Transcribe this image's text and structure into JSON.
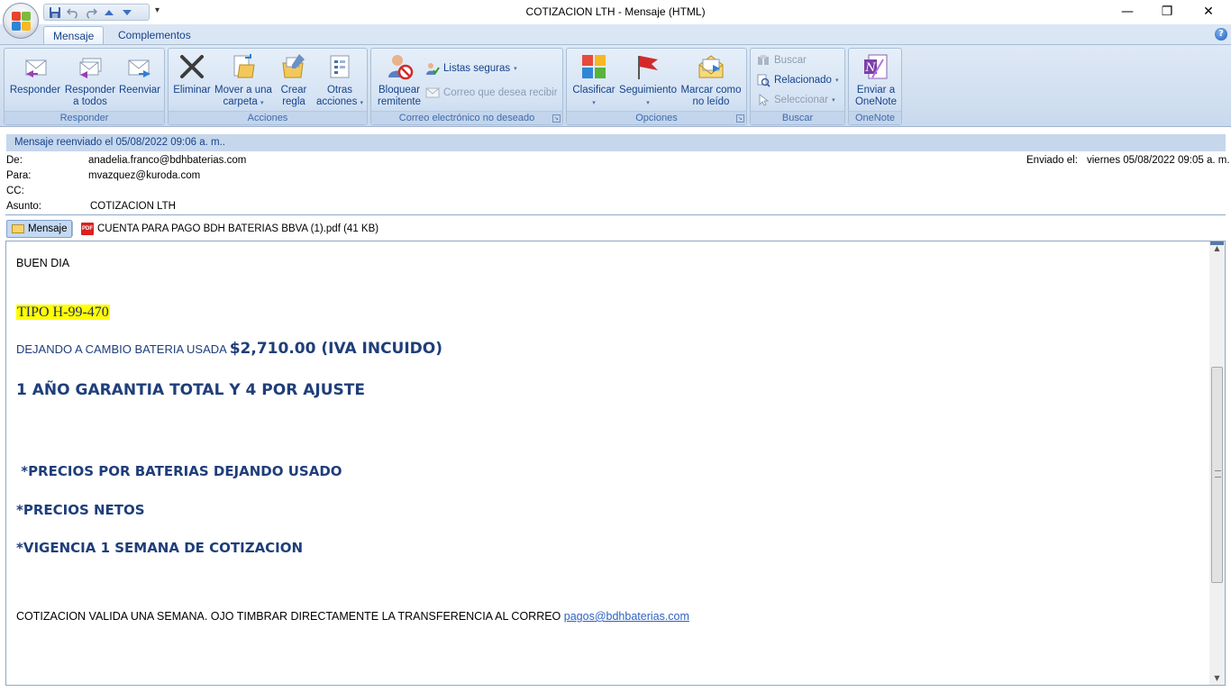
{
  "window": {
    "title": "COTIZACION LTH - Mensaje (HTML)",
    "minimize": "—",
    "restore": "❐",
    "close": "✕"
  },
  "quick_access": {
    "more": "▾"
  },
  "tabs": [
    {
      "label": "Mensaje",
      "active": true
    },
    {
      "label": "Complementos",
      "active": false
    }
  ],
  "help": "?",
  "ribbon": {
    "groups": {
      "responder": {
        "label": "Responder",
        "buttons": [
          {
            "label": "Responder",
            "icon": "reply-icon"
          },
          {
            "label": "Responder a todos",
            "icon": "reply-all-icon"
          },
          {
            "label": "Reenviar",
            "icon": "forward-icon"
          }
        ]
      },
      "acciones": {
        "label": "Acciones",
        "buttons": [
          {
            "label": "Eliminar",
            "icon": "delete-icon"
          },
          {
            "label": "Mover a una carpeta",
            "icon": "move-folder-icon"
          },
          {
            "label": "Crear regla",
            "icon": "create-rule-icon"
          },
          {
            "label": "Otras acciones",
            "icon": "other-actions-icon"
          }
        ]
      },
      "junk": {
        "label": "Correo electrónico no deseado",
        "buttons": [
          {
            "label": "Bloquear remitente",
            "icon": "block-sender-icon"
          },
          {
            "label": "Listas seguras",
            "icon": "safe-lists-icon"
          },
          {
            "label": "Correo que desea recibir",
            "icon": "not-junk-icon"
          }
        ]
      },
      "opciones": {
        "label": "Opciones",
        "buttons": [
          {
            "label": "Clasificar",
            "icon": "categorize-icon"
          },
          {
            "label": "Seguimiento",
            "icon": "follow-up-flag-icon"
          },
          {
            "label": "Marcar como no leído",
            "icon": "mark-unread-icon"
          }
        ]
      },
      "buscar": {
        "label": "Buscar",
        "buttons": [
          {
            "label": "Buscar",
            "icon": "find-icon"
          },
          {
            "label": "Relacionado",
            "icon": "related-icon"
          },
          {
            "label": "Seleccionar",
            "icon": "select-icon"
          }
        ]
      },
      "onenote": {
        "label": "OneNote",
        "buttons": [
          {
            "label": "Enviar a OneNote",
            "icon": "onenote-icon"
          }
        ]
      }
    }
  },
  "message": {
    "info_bar": "Mensaje reenviado el 05/08/2022 09:06 a. m..",
    "from_label": "De:",
    "from": "anadelia.franco@bdhbaterias.com",
    "to_label": "Para:",
    "to": "mvazquez@kuroda.com",
    "cc_label": "CC:",
    "cc": "",
    "subject_label": "Asunto:",
    "subject": "COTIZACION LTH",
    "sent_label": "Enviado el:",
    "sent": "viernes 05/08/2022 09:05 a. m."
  },
  "attachments": {
    "message_tab": "Mensaje",
    "file": "CUENTA PARA PAGO BDH BATERIAS BBVA (1).pdf (41 KB)"
  },
  "body": {
    "greeting": "BUEN DIA",
    "tipo": "TIPO H-99-470",
    "dejando_prefix": "DEJANDO A CAMBIO BATERIA USADA ",
    "price": "$2,710.00 (IVA INCUIDO)",
    "garantia": "1 AÑO GARANTIA TOTAL Y 4 POR AJUSTE",
    "note1": " *PRECIOS POR BATERIAS DEJANDO USADO",
    "note2": "*PRECIOS NETOS",
    "note3": "*VIGENCIA 1 SEMANA DE COTIZACION",
    "footer_text": "COTIZACION VALIDA UNA SEMANA. OJO TIMBRAR DIRECTAMENTE LA TRANSFERENCIA AL CORREO ",
    "footer_link": "pagos@bdhbaterias.com"
  }
}
